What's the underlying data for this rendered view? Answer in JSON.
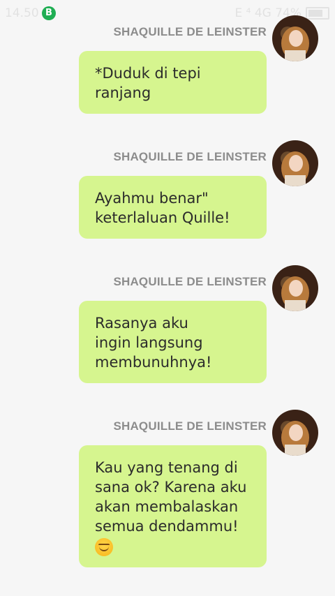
{
  "status_bar": {
    "time": "14.50",
    "bbm_label": "B",
    "indicators": "E ⁴ 4G 74%"
  },
  "messages": [
    {
      "sender": "SHAQUILLE DE LEINSTER",
      "lines": [
        "*Duduk di tepi",
        "ranjang"
      ]
    },
    {
      "sender": "SHAQUILLE DE LEINSTER",
      "lines": [
        "Ayahmu benar\"",
        "keterlaluan Quille!"
      ]
    },
    {
      "sender": "SHAQUILLE DE LEINSTER",
      "lines": [
        "Rasanya aku",
        "ingin langsung",
        "membunuhnya!"
      ]
    },
    {
      "sender": "SHAQUILLE DE LEINSTER",
      "lines": [
        "Kau yang tenang di",
        "sana ok? Karena aku",
        "akan membalaskan",
        "semua dendammu!"
      ],
      "emoji": "smiling-face-emoji"
    }
  ],
  "colors": {
    "bubble": "#d6f58f",
    "sender_name": "#8c8c8c",
    "background": "#f6f6f6"
  }
}
